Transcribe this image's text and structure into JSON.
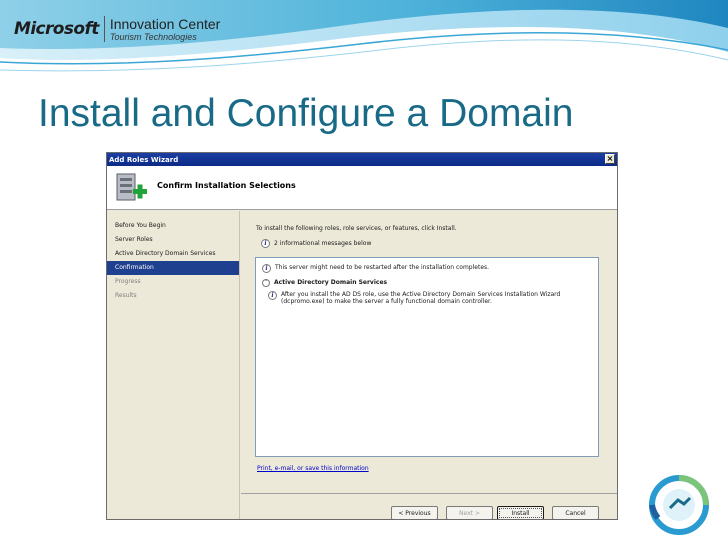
{
  "branding": {
    "company": "Microsoft",
    "center": "Innovation Center",
    "sub": "Tourism Technologies"
  },
  "slide": {
    "title": "Install and Configure a Domain"
  },
  "wizard": {
    "window_title": "Add Roles Wizard",
    "close_glyph": "×",
    "header_title": "Confirm Installation Selections",
    "nav": [
      {
        "label": "Before You Begin",
        "state": "normal"
      },
      {
        "label": "Server Roles",
        "state": "normal"
      },
      {
        "label": "Active Directory Domain Services",
        "state": "normal"
      },
      {
        "label": "Confirmation",
        "state": "selected"
      },
      {
        "label": "Progress",
        "state": "disabled"
      },
      {
        "label": "Results",
        "state": "disabled"
      }
    ],
    "intro": "To install the following roles, role services, or features, click Install.",
    "message_count": "2 informational messages below",
    "restart_warning": "This server might need to be restarted after the installation completes.",
    "section_title": "Active Directory Domain Services",
    "section_detail_1": "After you install the AD DS role, use the Active Directory Domain Services Installation Wizard",
    "section_detail_2": "(dcpromo.exe) to make the server a fully functional domain controller.",
    "link": "Print, e-mail, or save this information",
    "buttons": {
      "previous": "< Previous",
      "next": "Next >",
      "install": "Install",
      "cancel": "Cancel"
    }
  },
  "colors": {
    "title": "#196a87",
    "titlebar": "#0c2a86",
    "selected_nav": "#1f3f8f",
    "window_bg": "#ece9d8"
  },
  "icons": {
    "info": "i",
    "collapse": "˄"
  }
}
